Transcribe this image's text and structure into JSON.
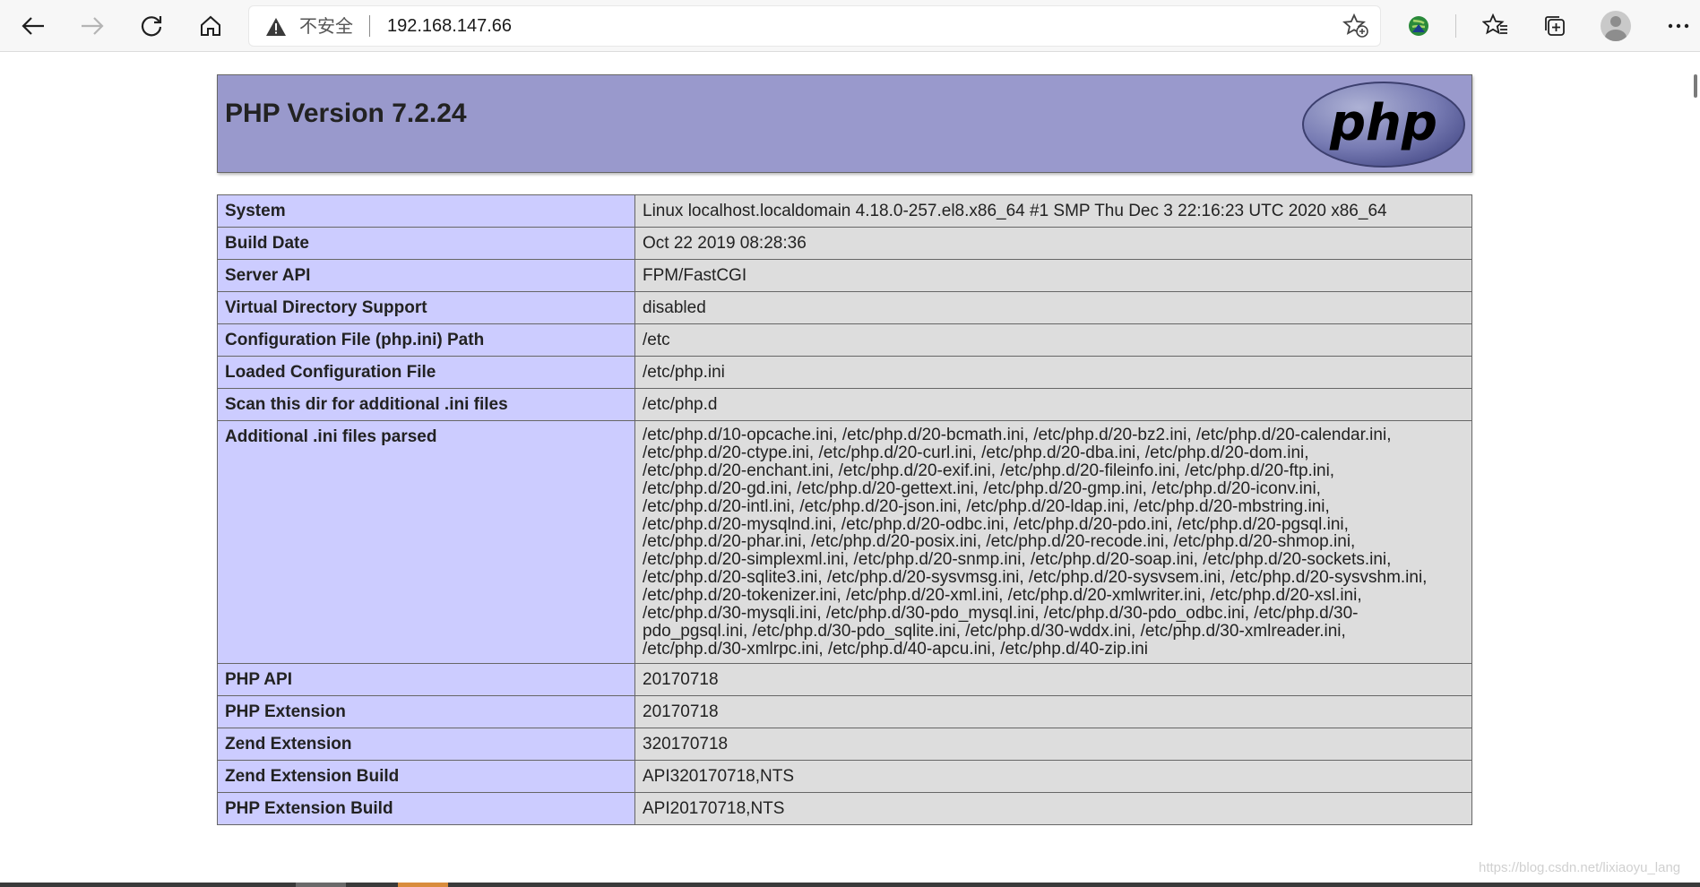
{
  "browser": {
    "security_label": "不安全",
    "url": "192.168.147.66",
    "icons": [
      "back-icon",
      "forward-icon",
      "refresh-icon",
      "home-icon",
      "warning-icon",
      "add-favorite-icon",
      "extension-icon",
      "favorites-icon",
      "collections-icon",
      "profile-avatar",
      "more-icon"
    ]
  },
  "header": {
    "title": "PHP Version 7.2.24",
    "logo_text": "php"
  },
  "rows": [
    {
      "key": "System",
      "value": "Linux localhost.localdomain 4.18.0-257.el8.x86_64 #1 SMP Thu Dec 3 22:16:23 UTC 2020 x86_64"
    },
    {
      "key": "Build Date",
      "value": "Oct 22 2019 08:28:36"
    },
    {
      "key": "Server API",
      "value": "FPM/FastCGI"
    },
    {
      "key": "Virtual Directory Support",
      "value": "disabled"
    },
    {
      "key": "Configuration File (php.ini) Path",
      "value": "/etc"
    },
    {
      "key": "Loaded Configuration File",
      "value": "/etc/php.ini"
    },
    {
      "key": "Scan this dir for additional .ini files",
      "value": "/etc/php.d"
    },
    {
      "key": "Additional .ini files parsed",
      "lines": [
        "/etc/php.d/10-opcache.ini, /etc/php.d/20-bcmath.ini, /etc/php.d/20-bz2.ini, /etc/php.d/20-calendar.ini,",
        "/etc/php.d/20-ctype.ini, /etc/php.d/20-curl.ini, /etc/php.d/20-dba.ini, /etc/php.d/20-dom.ini,",
        "/etc/php.d/20-enchant.ini, /etc/php.d/20-exif.ini, /etc/php.d/20-fileinfo.ini, /etc/php.d/20-ftp.ini,",
        "/etc/php.d/20-gd.ini, /etc/php.d/20-gettext.ini, /etc/php.d/20-gmp.ini, /etc/php.d/20-iconv.ini,",
        "/etc/php.d/20-intl.ini, /etc/php.d/20-json.ini, /etc/php.d/20-ldap.ini, /etc/php.d/20-mbstring.ini,",
        "/etc/php.d/20-mysqlnd.ini, /etc/php.d/20-odbc.ini, /etc/php.d/20-pdo.ini, /etc/php.d/20-pgsql.ini,",
        "/etc/php.d/20-phar.ini, /etc/php.d/20-posix.ini, /etc/php.d/20-recode.ini, /etc/php.d/20-shmop.ini,",
        "/etc/php.d/20-simplexml.ini, /etc/php.d/20-snmp.ini, /etc/php.d/20-soap.ini, /etc/php.d/20-sockets.ini,",
        "/etc/php.d/20-sqlite3.ini, /etc/php.d/20-sysvmsg.ini, /etc/php.d/20-sysvsem.ini, /etc/php.d/20-sysvshm.ini,",
        "/etc/php.d/20-tokenizer.ini, /etc/php.d/20-xml.ini, /etc/php.d/20-xmlwriter.ini, /etc/php.d/20-xsl.ini,",
        "/etc/php.d/30-mysqli.ini, /etc/php.d/30-pdo_mysql.ini, /etc/php.d/30-pdo_odbc.ini, /etc/php.d/30-",
        "pdo_pgsql.ini, /etc/php.d/30-pdo_sqlite.ini, /etc/php.d/30-wddx.ini, /etc/php.d/30-xmlreader.ini,",
        "/etc/php.d/30-xmlrpc.ini, /etc/php.d/40-apcu.ini, /etc/php.d/40-zip.ini"
      ]
    },
    {
      "key": "PHP API",
      "value": "20170718"
    },
    {
      "key": "PHP Extension",
      "value": "20170718"
    },
    {
      "key": "Zend Extension",
      "value": "320170718"
    },
    {
      "key": "Zend Extension Build",
      "value": "API320170718,NTS"
    },
    {
      "key": "PHP Extension Build",
      "value": "API20170718,NTS"
    }
  ],
  "watermark": "https://blog.csdn.net/lixiaoyu_lang",
  "colors": {
    "header_bg": "#9999cc",
    "key_bg": "#ccccff",
    "value_bg": "#dddddd"
  }
}
